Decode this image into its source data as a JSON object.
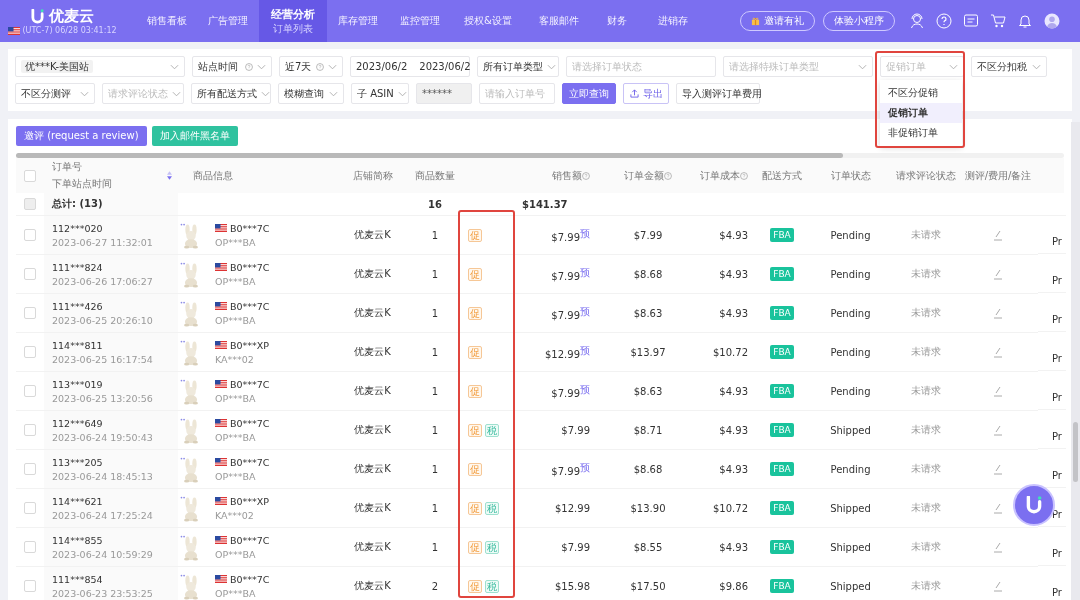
{
  "header": {
    "logo_text": "优麦云",
    "timezone": "(UTC-7) 06/28 03:41:12",
    "nav": [
      {
        "label": "销售看板",
        "selected": false
      },
      {
        "label": "广告管理",
        "selected": false
      },
      {
        "label": "经营分析",
        "sublabel": "订单列表",
        "selected": true
      },
      {
        "label": "库存管理",
        "selected": false
      },
      {
        "label": "监控管理",
        "selected": false
      },
      {
        "label": "授权&设置",
        "selected": false
      },
      {
        "label": "客服邮件",
        "selected": false
      },
      {
        "label": "财务",
        "selected": false
      },
      {
        "label": "进销存",
        "selected": false
      }
    ],
    "buttons": [
      {
        "label": "邀请有礼",
        "kind": "gift"
      },
      {
        "label": "体验小程序",
        "kind": "plain"
      }
    ]
  },
  "filters": [
    [
      {
        "kind": "tag_select",
        "value": "优***K-美国站"
      },
      {
        "kind": "select",
        "value": "站点时间",
        "help": true
      },
      {
        "kind": "select",
        "value": "近7天",
        "help": true
      },
      {
        "kind": "date_range",
        "start": "2023/06/2",
        "end": "2023/06/2"
      },
      {
        "kind": "select",
        "value": "所有订单类型",
        "help": false
      },
      {
        "kind": "input",
        "placeholder": "请选择订单状态"
      },
      {
        "kind": "select",
        "placeholder": "请选择特殊订单类型",
        "help": false
      },
      {
        "kind": "dropdown",
        "placeholder": "促销订单",
        "options": [
          {
            "label": "不区分促销",
            "selected": false
          },
          {
            "label": "促销订单",
            "selected": true
          },
          {
            "label": "非促销订单",
            "selected": false
          }
        ]
      },
      {
        "kind": "select",
        "value": "不区分扣税",
        "help": false
      }
    ],
    [
      {
        "kind": "select",
        "value": "不区分测评",
        "help": false
      },
      {
        "kind": "select",
        "placeholder": "请求评论状态",
        "help": false
      },
      {
        "kind": "select",
        "value": "所有配送方式",
        "help": false
      },
      {
        "kind": "select",
        "value": "模糊查询",
        "help": false
      },
      {
        "kind": "select",
        "value": "子 ASIN",
        "help": false
      },
      {
        "kind": "locked_input",
        "value": "******"
      },
      {
        "kind": "input",
        "placeholder": "请输入订单号"
      },
      {
        "kind": "primary",
        "label": "立即查询"
      },
      {
        "kind": "export",
        "label": "导出"
      },
      {
        "kind": "button",
        "label": "导入测评订单费用"
      }
    ]
  ],
  "actions": [
    {
      "label": "邀评 (request a review)",
      "kind": "primary"
    },
    {
      "label": "加入邮件黑名单",
      "kind": "success"
    }
  ],
  "table": {
    "select_all": {
      "checked": false
    },
    "columns": [
      {
        "label": "订单号",
        "sublabel": "下单站点时间",
        "help": false
      },
      {
        "label": "商品信息",
        "help": false
      },
      {
        "label": "店铺简称",
        "help": false
      },
      {
        "label": "商品数量",
        "help": false
      },
      {
        "label": "销售额",
        "help": true
      },
      {
        "label": "订单金额",
        "help": true
      },
      {
        "label": "订单成本",
        "help": true
      },
      {
        "label": "配送方式",
        "help": false
      },
      {
        "label": "订单状态",
        "help": false
      },
      {
        "label": "请求评论状态",
        "help": false
      },
      {
        "label": "测评/费用/备注",
        "help": false
      }
    ],
    "total": {
      "label": "总计: (13)",
      "quantity": "16",
      "sales": "$141.37",
      "checked": false
    },
    "rows": [
      {
        "order": "112***020",
        "time": "2023-06-27 11:32:01",
        "asin": "B0***7C",
        "sku": "OP***BA",
        "store": "优麦云K",
        "qty": "1",
        "tags": [
          {
            "label": "促",
            "kind": "promo"
          }
        ],
        "sales": "$7.99$^{预}$",
        "amount": "$7.99",
        "cost": "$4.93",
        "ship": "FBA",
        "status": "Pending",
        "review": "未请求",
        "extra": "Pr",
        "checked": false
      },
      {
        "order": "111***824",
        "time": "2023-06-26 17:06:27",
        "asin": "B0***7C",
        "sku": "OP***BA",
        "store": "优麦云K",
        "qty": "1",
        "tags": [
          {
            "label": "促",
            "kind": "promo"
          }
        ],
        "sales": "$7.99$^{预}$",
        "amount": "$8.68",
        "cost": "$4.93",
        "ship": "FBA",
        "status": "Pending",
        "review": "未请求",
        "extra": "Pr",
        "checked": false
      },
      {
        "order": "111***426",
        "time": "2023-06-25 20:26:10",
        "asin": "B0***7C",
        "sku": "OP***BA",
        "store": "优麦云K",
        "qty": "1",
        "tags": [
          {
            "label": "促",
            "kind": "promo"
          }
        ],
        "sales": "$7.99$^{预}$",
        "amount": "$8.63",
        "cost": "$4.93",
        "ship": "FBA",
        "status": "Pending",
        "review": "未请求",
        "extra": "Pr",
        "checked": false
      },
      {
        "order": "114***811",
        "time": "2023-06-25 16:17:54",
        "asin": "B0***XP",
        "sku": "KA***02",
        "store": "优麦云K",
        "qty": "1",
        "tags": [
          {
            "label": "促",
            "kind": "promo"
          }
        ],
        "sales": "$12.99$^{预}$",
        "amount": "$13.97",
        "cost": "$10.72",
        "ship": "FBA",
        "status": "Pending",
        "review": "未请求",
        "extra": "Pr",
        "checked": false
      },
      {
        "order": "113***019",
        "time": "2023-06-25 13:20:56",
        "asin": "B0***7C",
        "sku": "OP***BA",
        "store": "优麦云K",
        "qty": "1",
        "tags": [
          {
            "label": "促",
            "kind": "promo"
          }
        ],
        "sales": "$7.99$^{预}$",
        "amount": "$8.63",
        "cost": "$4.93",
        "ship": "FBA",
        "status": "Pending",
        "review": "未请求",
        "extra": "Pr",
        "checked": false
      },
      {
        "order": "112***649",
        "time": "2023-06-24 19:50:43",
        "asin": "B0***7C",
        "sku": "OP***BA",
        "store": "优麦云K",
        "qty": "1",
        "tags": [
          {
            "label": "促",
            "kind": "promo"
          },
          {
            "label": "税",
            "kind": "tax"
          }
        ],
        "sales": "$7.99",
        "amount": "$8.71",
        "cost": "$4.93",
        "ship": "FBA",
        "status": "Shipped",
        "review": "未请求",
        "extra": "Pr",
        "checked": false
      },
      {
        "order": "113***205",
        "time": "2023-06-24 18:45:13",
        "asin": "B0***7C",
        "sku": "OP***BA",
        "store": "优麦云K",
        "qty": "1",
        "tags": [
          {
            "label": "促",
            "kind": "promo"
          }
        ],
        "sales": "$7.99$^{预}$",
        "amount": "$8.68",
        "cost": "$4.93",
        "ship": "FBA",
        "status": "Pending",
        "review": "未请求",
        "extra": "Pr",
        "checked": false
      },
      {
        "order": "114***621",
        "time": "2023-06-24 17:25:24",
        "asin": "B0***XP",
        "sku": "KA***02",
        "store": "优麦云K",
        "qty": "1",
        "tags": [
          {
            "label": "促",
            "kind": "promo"
          },
          {
            "label": "税",
            "kind": "tax"
          }
        ],
        "sales": "$12.99",
        "amount": "$13.90",
        "cost": "$10.72",
        "ship": "FBA",
        "status": "Shipped",
        "review": "未请求",
        "extra": "Pr",
        "checked": false
      },
      {
        "order": "114***855",
        "time": "2023-06-24 10:59:29",
        "asin": "B0***7C",
        "sku": "OP***BA",
        "store": "优麦云K",
        "qty": "1",
        "tags": [
          {
            "label": "促",
            "kind": "promo"
          },
          {
            "label": "税",
            "kind": "tax"
          }
        ],
        "sales": "$7.99",
        "amount": "$8.55",
        "cost": "$4.93",
        "ship": "FBA",
        "status": "Shipped",
        "review": "未请求",
        "extra": "Pr",
        "checked": false
      },
      {
        "order": "111***854",
        "time": "2023-06-23 23:53:25",
        "asin": "B0***7C",
        "sku": "OP***BA",
        "store": "优麦云K",
        "qty": "2",
        "tags": [
          {
            "label": "促",
            "kind": "promo"
          },
          {
            "label": "税",
            "kind": "tax"
          }
        ],
        "sales": "$15.98",
        "amount": "$17.50",
        "cost": "$9.86",
        "ship": "FBA",
        "status": "Shipped",
        "review": "未请求",
        "extra": "Pr",
        "checked": false
      }
    ]
  }
}
